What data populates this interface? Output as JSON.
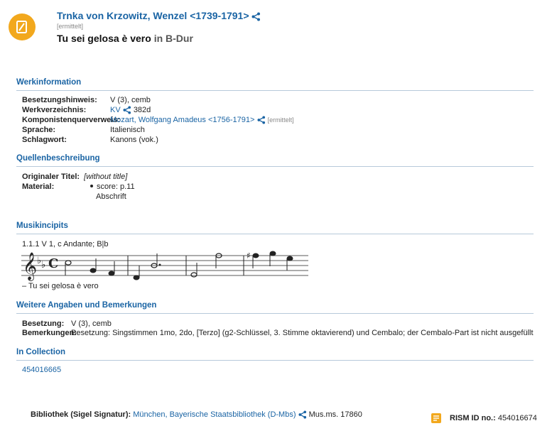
{
  "record": {
    "composer": "Trnka von Krzowitz, Wenzel <1739-1791>",
    "composer_note": "[ermittelt]",
    "title": "Tu sei gelosa è vero",
    "key_prefix": "in",
    "key": "B-Dur"
  },
  "werkinformation": {
    "heading": "Werkinformation",
    "rows": [
      {
        "label": "Besetzungshinweis:",
        "value": "V (3), cemb"
      },
      {
        "label": "Werkverzeichnis:",
        "link": "KV",
        "value": "382d"
      },
      {
        "label": "Komponistenquerverweis:",
        "link": "Mozart, Wolfgang Amadeus <1756-1791>",
        "note": "[ermittelt]"
      },
      {
        "label": "Sprache:",
        "value": "Italienisch"
      },
      {
        "label": "Schlagwort:",
        "value": "Kanons (vok.)"
      }
    ]
  },
  "quellen": {
    "heading": "Quellenbeschreibung",
    "original_title_label": "Originaler Titel:",
    "original_title": "[without title]",
    "material_label": "Material:",
    "material_item": "score: p.11",
    "material_sub": "Abschrift"
  },
  "incipit": {
    "heading": "Musikincipits",
    "caption": "1.1.1 V 1, c Andante; B|b",
    "text": "– Tu sei gelosa è vero"
  },
  "weitere": {
    "heading": "Weitere Angaben und Bemerkungen",
    "rows": [
      {
        "label": "Besetzung:",
        "value": "V (3), cemb"
      },
      {
        "label": "Bemerkungen:",
        "value": "Besetzung: Singstimmen 1mo, 2do, [Terzo] (g2-Schlüssel, 3. Stimme oktavierend) und Cembalo; der Cembalo-Part ist nicht ausgefüllt"
      }
    ]
  },
  "collection": {
    "heading": "In Collection",
    "id": "454016665"
  },
  "footer": {
    "library_label": "Bibliothek (Sigel Signatur):",
    "library_link": "München, Bayerische Staatsbibliothek (D-Mbs)",
    "shelfmark": "Mus.ms. 17860",
    "rism_label": "RISM ID no.:",
    "rism_id": "454016674"
  },
  "colors": {
    "link": "#1a64a4",
    "accent": "#f2a81d",
    "rule": "#b7c9da"
  },
  "icons": {
    "logo": "rism-logo",
    "share": "share-icon",
    "rism": "rism-badge-icon"
  }
}
